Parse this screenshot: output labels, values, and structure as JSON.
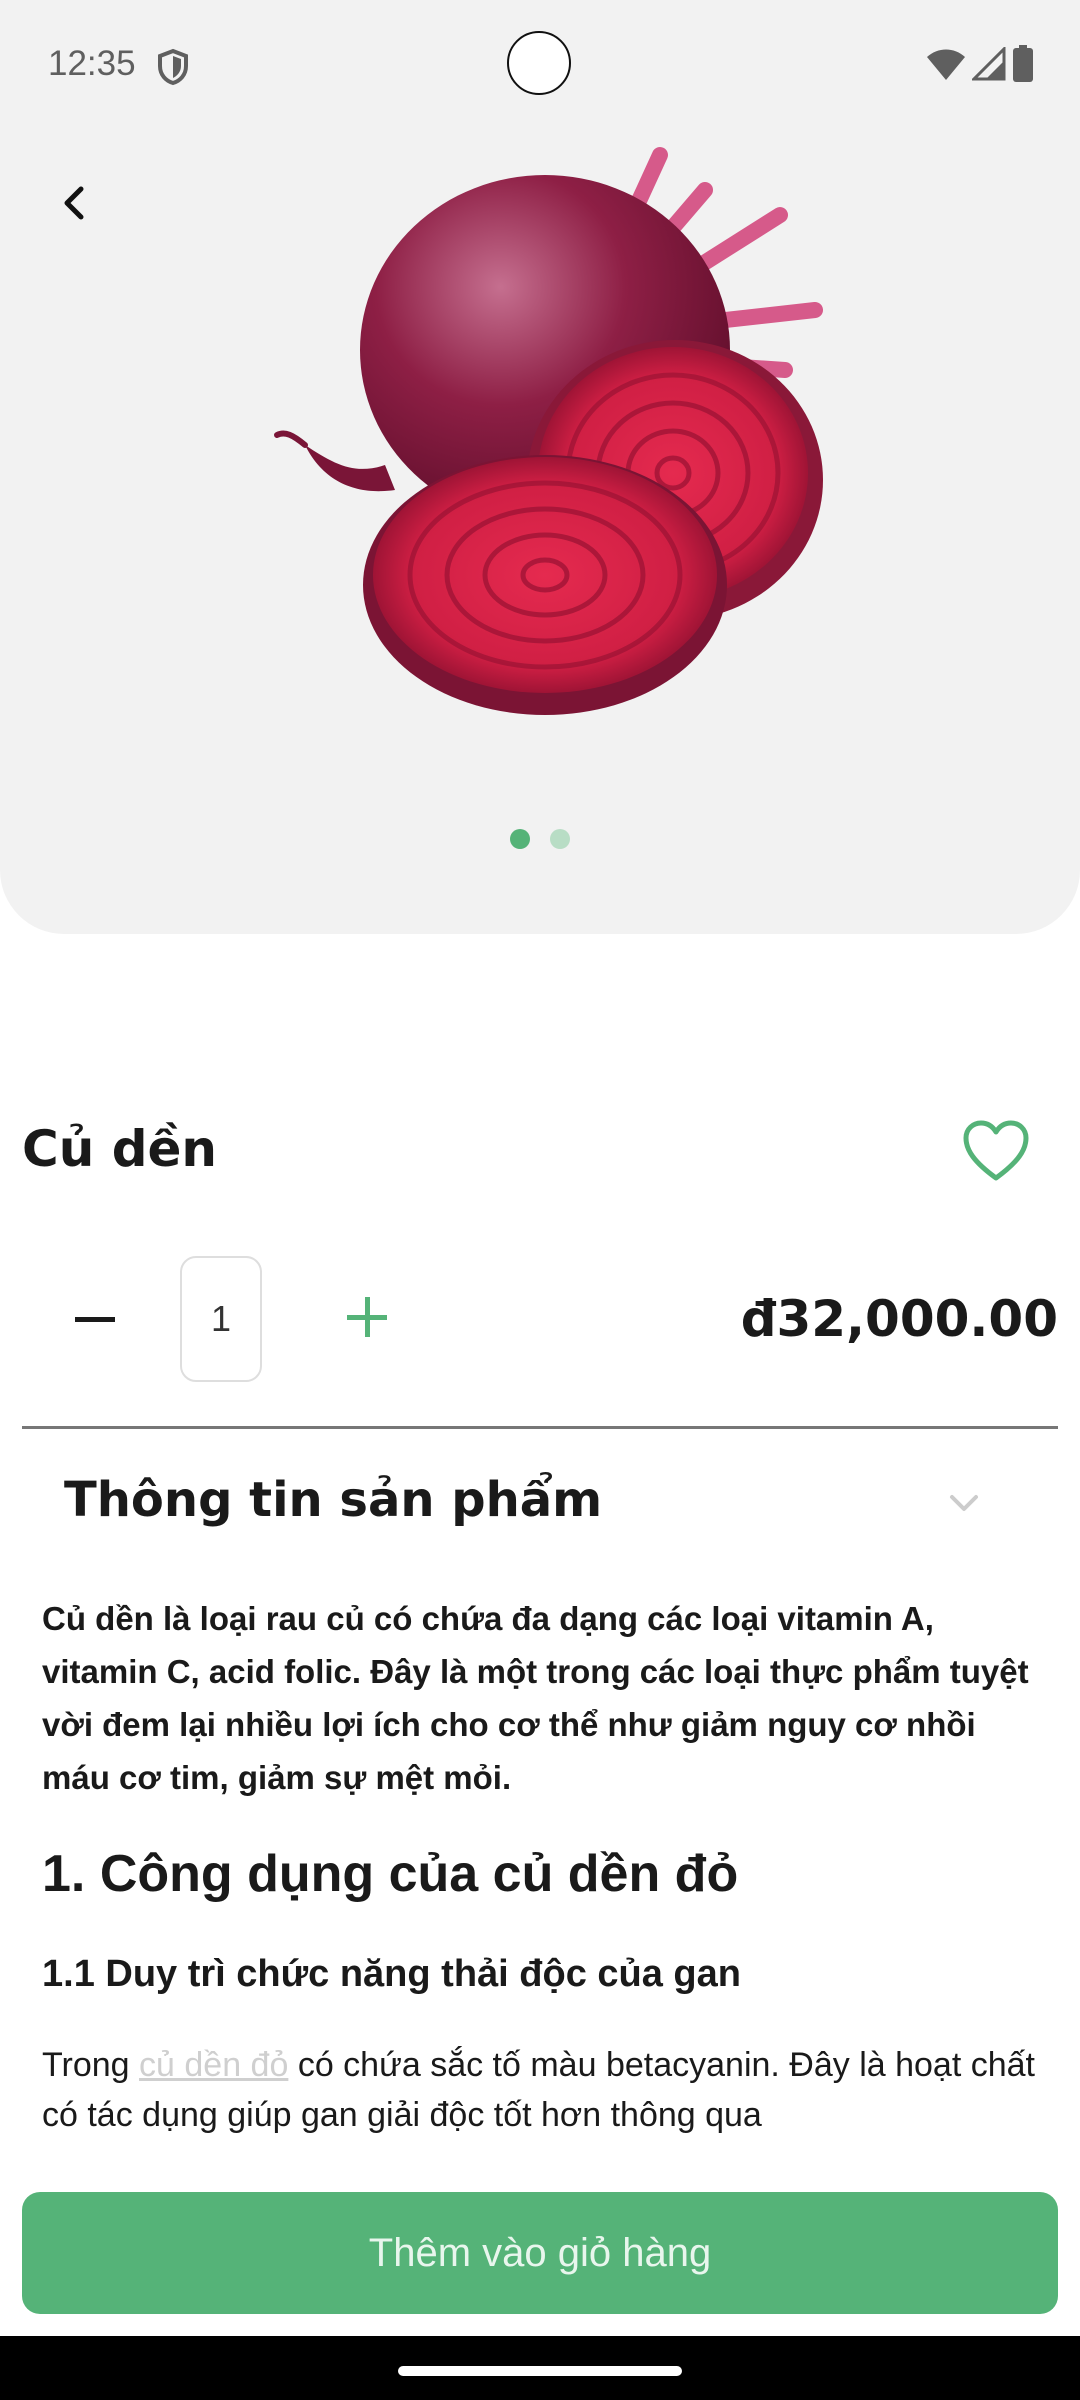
{
  "status_bar": {
    "time": "12:35",
    "icons": [
      "shield-icon",
      "wifi-icon",
      "signal-icon",
      "battery-icon"
    ]
  },
  "hero": {
    "image": "beetroot-image",
    "carousel": {
      "count": 2,
      "active_index": 0
    }
  },
  "product": {
    "name": "Củ dền",
    "quantity": "1",
    "price": "đ32,000.00",
    "favorite": false
  },
  "info_section": {
    "title": "Thông tin sản phẩm",
    "description": "Củ dền là loại rau củ có chứa đa dạng các loại vitamin A, vitamin C, acid folic. Đây là một trong các loại thực phẩm tuyệt vời đem lại nhiều lợi ích cho cơ thể như giảm nguy cơ nhồi máu cơ tim, giảm sự mệt mỏi.",
    "heading_1": "1. Công dụng của củ dền đỏ",
    "heading_1_1": "1.1 Duy trì chức năng thải độc của gan",
    "paragraph_prefix": "Trong ",
    "paragraph_link": "củ dền đỏ",
    "paragraph_suffix": " có chứa sắc tố màu betacyanin. Đây là hoạt chất có tác dụng giúp gan giải độc tốt hơn thông qua"
  },
  "cta": {
    "label": "Thêm vào giỏ hàng"
  },
  "colors": {
    "accent": "#55b378",
    "accent_light": "#b8ddc5",
    "hero_background": "#f2f2f2",
    "text": "#1a1a1a"
  }
}
